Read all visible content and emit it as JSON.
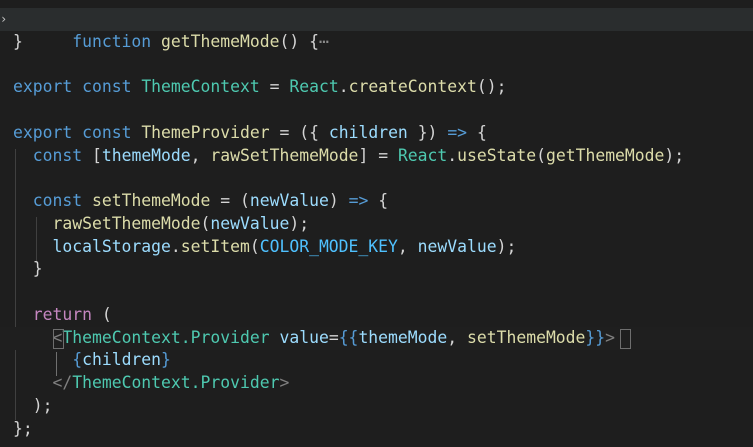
{
  "lines": [
    {
      "k1": "function",
      "fn": "getThemeMode",
      "p1": "()",
      "brace": "{",
      "ell": "⋯"
    },
    {
      "t": "}"
    },
    {
      "export": "export",
      "const": "const",
      "name": "ThemeContext",
      "eq": "=",
      "react": "React",
      "dot": ".",
      "fn": "createContext",
      "end": "();"
    },
    {
      "export": "export",
      "const": "const",
      "name": "ThemeProvider",
      "eq": "=",
      "open": "({",
      "children": "children",
      "close": "})",
      "arrow": "=>",
      "brace": "{"
    },
    {
      "const": "const",
      "lb": "[",
      "v1": "themeMode",
      "comma": ",",
      "v2": "rawSetThemeMode",
      "rb": "]",
      "eq": "=",
      "react": "React",
      "dot": ".",
      "fn": "useState",
      "lp": "(",
      "arg": "getThemeMode",
      "end": ");"
    },
    {
      "const": "const",
      "name": "setThemeMode",
      "eq": "=",
      "lp": "(",
      "arg": "newValue",
      "rp": ")",
      "arrow": "=>",
      "brace": "{"
    },
    {
      "fn": "rawSetThemeMode",
      "lp": "(",
      "arg": "newValue",
      "end": ");"
    },
    {
      "obj": "localStorage",
      "dot": ".",
      "fn": "setItem",
      "lp": "(",
      "key": "COLOR_MODE_KEY",
      "comma": ",",
      "arg": "newValue",
      "end": ");"
    },
    {
      "t": "}"
    },
    {
      "ret": "return",
      "lp": "("
    },
    {
      "lt": "<",
      "comp": "ThemeContext.Provider",
      "attr": "value",
      "eq": "=",
      "lb": "{{",
      "v1": "themeMode",
      "comma": ",",
      "v2": "setThemeMode",
      "rb": "}}",
      "gt": ">"
    },
    {
      "lb": "{",
      "v": "children",
      "rb": "}"
    },
    {
      "lt": "</",
      "comp": "ThemeContext.Provider",
      "gt": ">"
    },
    {
      "t": ");"
    },
    {
      "t": "};"
    }
  ],
  "colors": {
    "background": "#1e1e1e",
    "keyword": "#569cd6",
    "control": "#c586c0",
    "function": "#dcdcaa",
    "variable": "#9cdcfe",
    "class": "#4ec9b0",
    "constant": "#4fc1ff"
  }
}
